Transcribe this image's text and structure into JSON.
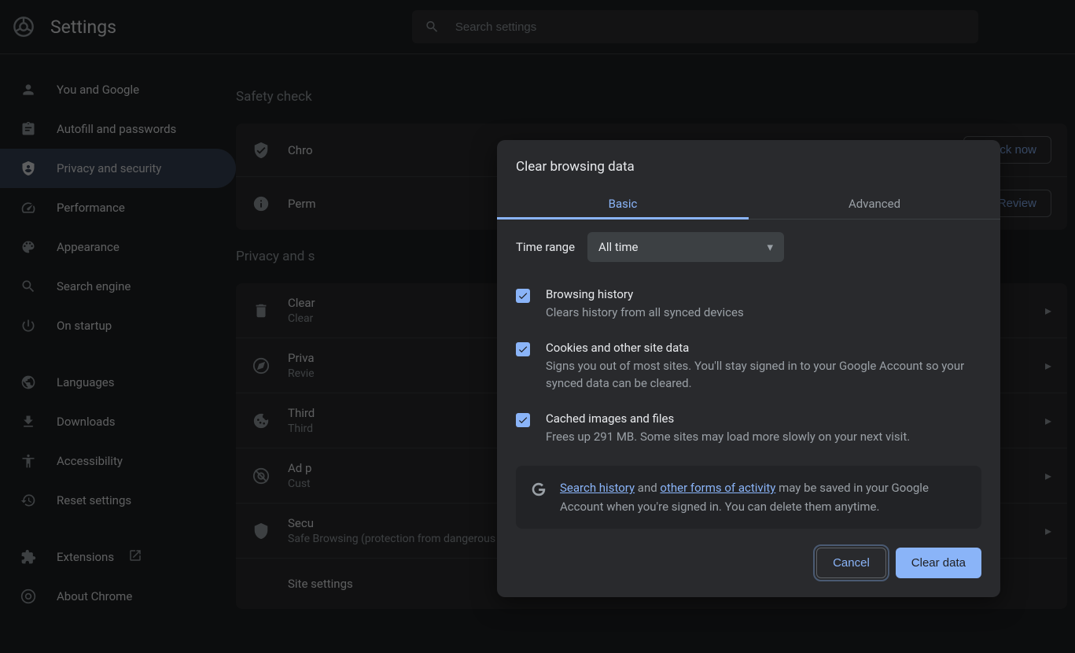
{
  "header": {
    "title": "Settings",
    "search_placeholder": "Search settings"
  },
  "sidebar": {
    "items": [
      {
        "label": "You and Google",
        "icon": "person"
      },
      {
        "label": "Autofill and passwords",
        "icon": "clipboard"
      },
      {
        "label": "Privacy and security",
        "icon": "shield",
        "active": true
      },
      {
        "label": "Performance",
        "icon": "speed"
      },
      {
        "label": "Appearance",
        "icon": "palette"
      },
      {
        "label": "Search engine",
        "icon": "search"
      },
      {
        "label": "On startup",
        "icon": "power"
      }
    ],
    "items2": [
      {
        "label": "Languages",
        "icon": "globe"
      },
      {
        "label": "Downloads",
        "icon": "download"
      },
      {
        "label": "Accessibility",
        "icon": "accessibility"
      },
      {
        "label": "Reset settings",
        "icon": "history"
      }
    ],
    "items3": [
      {
        "label": "Extensions",
        "icon": "extension",
        "extlink": true
      },
      {
        "label": "About Chrome",
        "icon": "chrome"
      }
    ]
  },
  "main": {
    "safety_heading": "Safety check",
    "safety_rows": [
      {
        "title": "Chro",
        "button": "Check now"
      },
      {
        "title": "Perm",
        "button": "Review"
      }
    ],
    "privacy_heading": "Privacy and s",
    "privacy_rows": [
      {
        "title": "Clear",
        "sub": "Clear"
      },
      {
        "title": "Priva",
        "sub": "Revie"
      },
      {
        "title": "Third",
        "sub": "Third"
      },
      {
        "title": "Ad p",
        "sub": "Cust"
      },
      {
        "title": "Secu",
        "sub": "Safe Browsing (protection from dangerous sites) and other security settings"
      },
      {
        "title": "Site settings"
      }
    ]
  },
  "dialog": {
    "title": "Clear browsing data",
    "tabs": [
      "Basic",
      "Advanced"
    ],
    "time_range_label": "Time range",
    "time_range_value": "All time",
    "checks": [
      {
        "title": "Browsing history",
        "sub": "Clears history from all synced devices"
      },
      {
        "title": "Cookies and other site data",
        "sub": "Signs you out of most sites. You'll stay signed in to your Google Account so your synced data can be cleared."
      },
      {
        "title": "Cached images and files",
        "sub": "Frees up 291 MB. Some sites may load more slowly on your next visit."
      }
    ],
    "info": {
      "link1": "Search history",
      "mid1": " and ",
      "link2": "other forms of activity",
      "tail": " may be saved in your Google Account when you're signed in. You can delete them anytime."
    },
    "cancel": "Cancel",
    "clear": "Clear data"
  }
}
